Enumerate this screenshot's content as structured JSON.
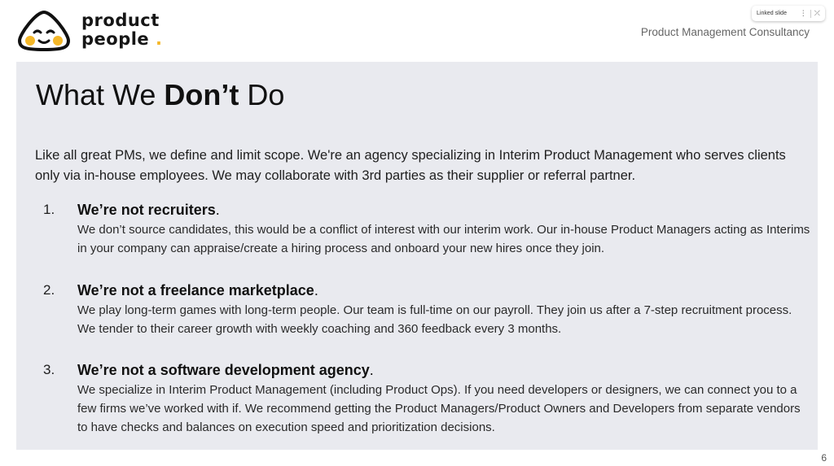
{
  "logo": {
    "line1": "product",
    "line2": "people",
    "dot": ".",
    "colors": {
      "face": "#fff",
      "outline": "#111111",
      "accent": "#f4b728"
    }
  },
  "linked_chip": {
    "label": "Linked slide",
    "menu_icon": "more-vert-icon",
    "unlink_icon": "unlink-icon"
  },
  "header": {
    "subtitle": "Product Management Consultancy"
  },
  "slide": {
    "title_prefix": "What We ",
    "title_bold": "Don’t",
    "title_suffix": " Do",
    "intro": "Like all great PMs, we define and limit scope. We're an agency specializing in Interim Product Management who serves clients only via in-house employees. We may collaborate with 3rd parties as their supplier or referral partner.",
    "items": [
      {
        "number": "1.",
        "title": "We’re not recruiters",
        "title_end": ".",
        "body": "We don’t source candidates, this would be a conflict of interest with our interim work. Our in-house Product Managers acting as Interims in your company can appraise/create a hiring process and onboard your new hires once they join."
      },
      {
        "number": "2.",
        "title": "We’re not a freelance marketplace",
        "title_end": ".",
        "body": "We play long-term games with long-term people. Our team is full-time on our payroll. They  join us after a 7-step recruitment process. We tender to their career growth with weekly coaching and 360 feedback every 3 months."
      },
      {
        "number": "3.",
        "title": "We’re not a software development agency",
        "title_end": ".",
        "body": "We specialize in Interim Product Management (including Product Ops). If you need developers or designers, we can connect you to a few firms we’ve worked with if. We recommend getting the Product Managers/Product Owners and Developers from separate vendors to have checks and balances on execution speed and prioritization decisions."
      }
    ]
  },
  "page_number": "6",
  "colors": {
    "panel_bg": "#e9eaef",
    "subtitle": "#666666"
  }
}
